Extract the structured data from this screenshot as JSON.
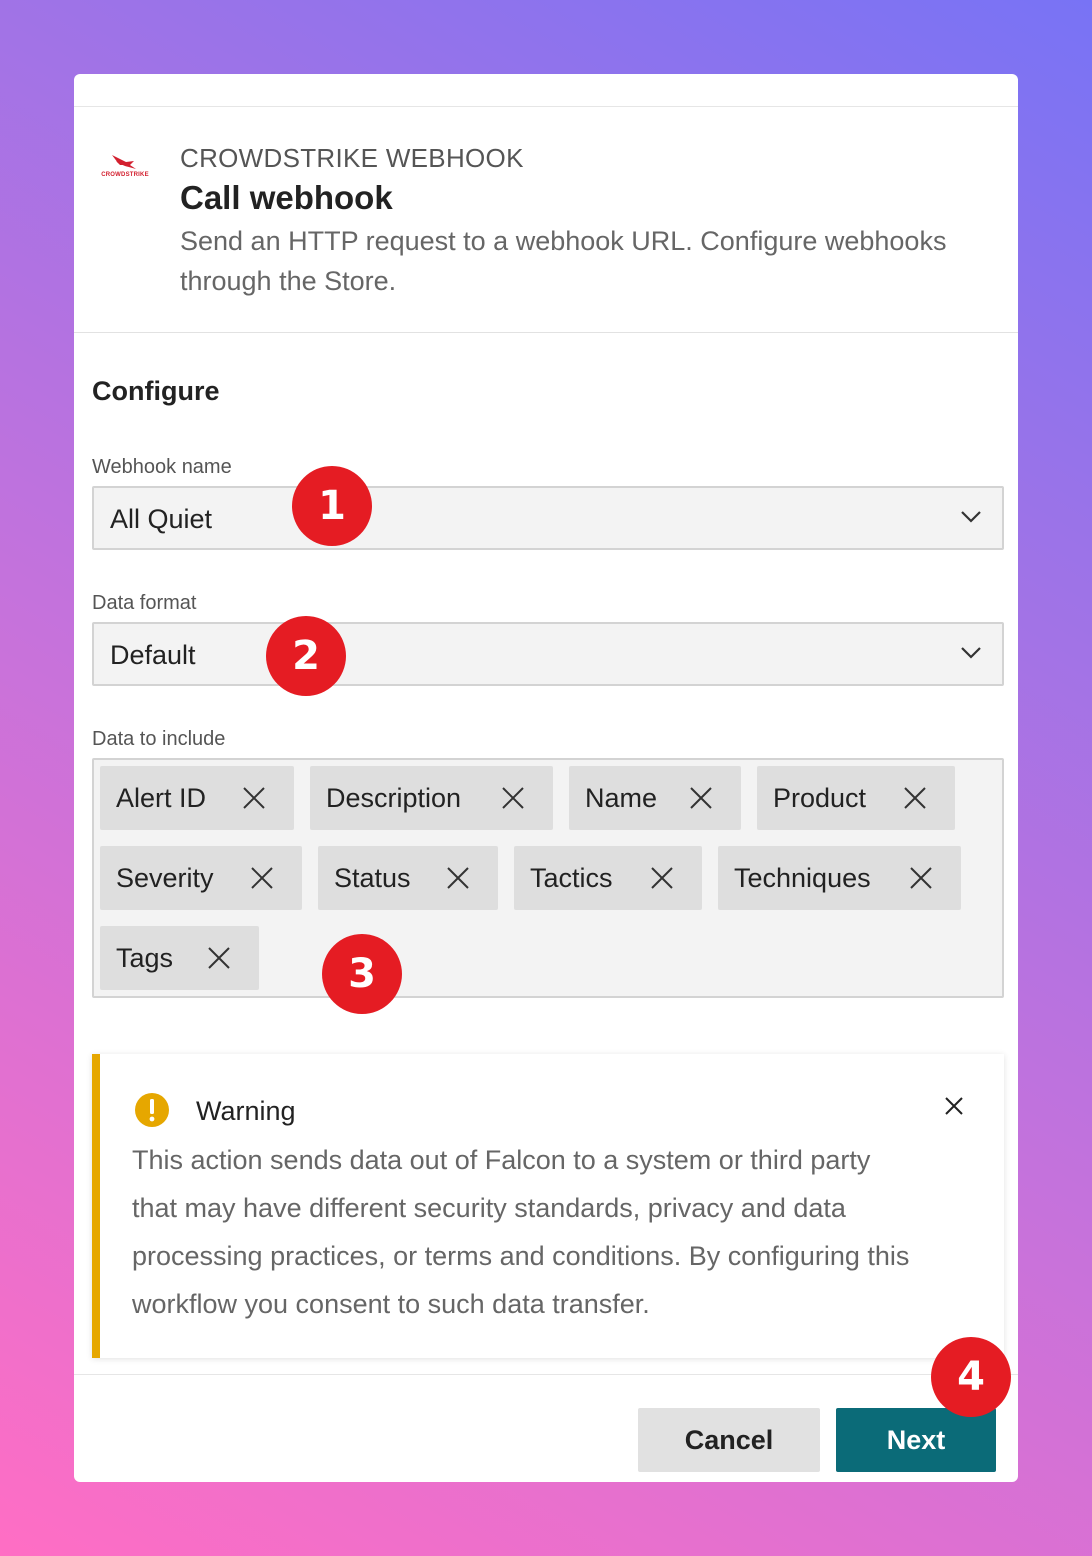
{
  "header": {
    "logo_text": "CROWDSTRIKE",
    "eyebrow": "CROWDSTRIKE WEBHOOK",
    "title": "Call webhook",
    "description": "Send an HTTP request to a webhook URL. Configure webhooks through the Store."
  },
  "configure": {
    "section_title": "Configure",
    "webhook_name": {
      "label": "Webhook name",
      "value": "All Quiet"
    },
    "data_format": {
      "label": "Data format",
      "value": "Default"
    },
    "data_to_include": {
      "label": "Data to include",
      "chips": [
        "Alert ID",
        "Description",
        "Name",
        "Product",
        "Severity",
        "Status",
        "Tactics",
        "Techniques",
        "Tags"
      ]
    }
  },
  "warning": {
    "title": "Warning",
    "text": "This action sends data out of Falcon to a system or third party that may have different security standards, privacy and data processing practices, or terms and conditions. By configuring this workflow you consent to such data transfer.",
    "color": "#e6a700"
  },
  "footer": {
    "cancel_label": "Cancel",
    "next_label": "Next",
    "next_color": "#0b6b78"
  },
  "annotations": [
    "1",
    "2",
    "3",
    "4"
  ]
}
